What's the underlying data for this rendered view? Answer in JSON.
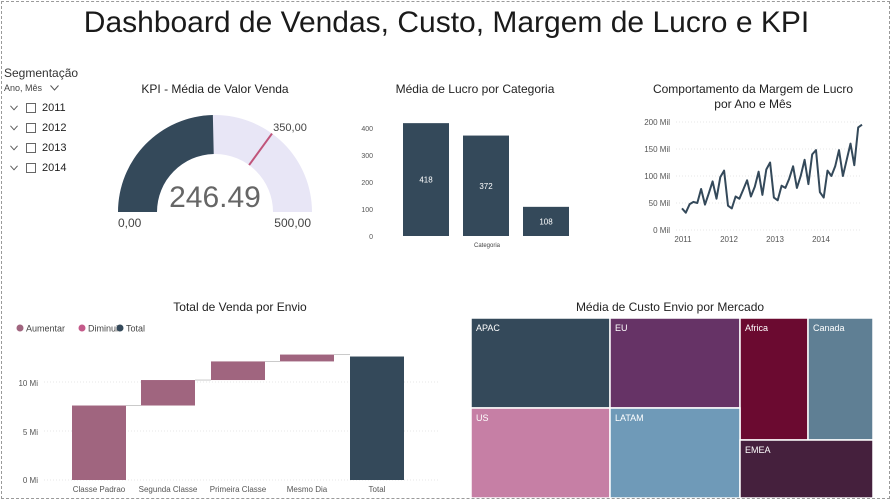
{
  "dashboard": {
    "title": "Dashboard de Vendas, Custo, Margem de Lucro e KPI"
  },
  "slicer": {
    "title": "Segmentação",
    "field": "Ano, Mês",
    "items": [
      {
        "label": "2011"
      },
      {
        "label": "2012"
      },
      {
        "label": "2013"
      },
      {
        "label": "2014"
      }
    ]
  },
  "colors": {
    "dark": "#34495a",
    "gauge_fill": "#e8e6f6",
    "target": "#c0547a",
    "increase": "#a0657f",
    "decrease": "#c45a8a"
  },
  "gauge": {
    "title": "KPI - Média de Valor Venda",
    "value_label": "246.49",
    "min_label": "0,00",
    "max_label": "500,00",
    "target_label": "350,00",
    "value": 246.49,
    "min": 0,
    "max": 500,
    "target": 350
  },
  "category_chart": {
    "title": "Média de Lucro por Categoria",
    "xlabel": "Categoria",
    "yticks": [
      "0",
      "100",
      "200",
      "300",
      "400"
    ]
  },
  "line_chart": {
    "title_line1": "Comportamento da Margem de Lucro",
    "title_line2": "por Ano e Mês",
    "yticks": [
      "0 Mil",
      "50 Mil",
      "100 Mil",
      "150 Mil",
      "200 Mil"
    ],
    "xticks": [
      "2011",
      "2012",
      "2013",
      "2014"
    ]
  },
  "waterfall": {
    "title": "Total de Venda por Envio",
    "legend": [
      {
        "label": "Aumentar",
        "color": "#a0657f"
      },
      {
        "label": "Diminuir",
        "color": "#c45a8a"
      },
      {
        "label": "Total",
        "color": "#34495a"
      }
    ],
    "yticks": [
      "0 Mi",
      "5 Mi",
      "10 Mi"
    ]
  },
  "treemap": {
    "title": "Média de Custo Envio por Mercado",
    "tiles": [
      {
        "label": "APAC",
        "color": "#34495a"
      },
      {
        "label": "EU",
        "color": "#663366"
      },
      {
        "label": "Africa",
        "color": "#6b0a30"
      },
      {
        "label": "Canada",
        "color": "#5f7f94"
      },
      {
        "label": "US",
        "color": "#c67fa5"
      },
      {
        "label": "LATAM",
        "color": "#6f9ab8"
      },
      {
        "label": "EMEA",
        "color": "#45203d"
      }
    ]
  },
  "chart_data": [
    {
      "type": "bar",
      "title": "Média de Lucro por Categoria",
      "xlabel": "Categoria",
      "ylabel": "",
      "ylim": [
        0,
        450
      ],
      "categories": [
        "",
        "",
        ""
      ],
      "values": [
        418,
        372,
        108
      ],
      "labels": [
        "418",
        "372",
        "108"
      ]
    },
    {
      "type": "line",
      "title": "Comportamento da Margem de Lucro por Ano e Mês",
      "ylim": [
        0,
        200
      ],
      "x": [
        "2011-01",
        "2011-02",
        "2011-03",
        "2011-04",
        "2011-05",
        "2011-06",
        "2011-07",
        "2011-08",
        "2011-09",
        "2011-10",
        "2011-11",
        "2011-12",
        "2012-01",
        "2012-02",
        "2012-03",
        "2012-04",
        "2012-05",
        "2012-06",
        "2012-07",
        "2012-08",
        "2012-09",
        "2012-10",
        "2012-11",
        "2012-12",
        "2013-01",
        "2013-02",
        "2013-03",
        "2013-04",
        "2013-05",
        "2013-06",
        "2013-07",
        "2013-08",
        "2013-09",
        "2013-10",
        "2013-11",
        "2013-12",
        "2014-01",
        "2014-02",
        "2014-03",
        "2014-04",
        "2014-05",
        "2014-06",
        "2014-07",
        "2014-08",
        "2014-09",
        "2014-10",
        "2014-11",
        "2014-12"
      ],
      "series": [
        {
          "values": [
            40,
            32,
            48,
            52,
            50,
            76,
            47,
            68,
            90,
            58,
            98,
            110,
            45,
            40,
            62,
            58,
            75,
            92,
            62,
            80,
            108,
            65,
            112,
            125,
            60,
            55,
            82,
            78,
            95,
            118,
            78,
            100,
            130,
            85,
            140,
            148,
            70,
            60,
            110,
            100,
            118,
            148,
            100,
            130,
            160,
            120,
            190,
            195
          ]
        }
      ]
    },
    {
      "type": "bar",
      "title": "Total de Venda por Envio",
      "ylim": [
        0,
        14
      ],
      "categories": [
        "Classe Padrao",
        "Segunda Classe",
        "Primeira Classe",
        "Mesmo Dia",
        "Total"
      ],
      "values": [
        7.6,
        2.6,
        1.9,
        0.7,
        12.6
      ],
      "kinds": [
        "Aumentar",
        "Aumentar",
        "Aumentar",
        "Aumentar",
        "Total"
      ]
    },
    {
      "type": "treemap",
      "title": "Média de Custo Envio por Mercado",
      "categories": [
        "APAC",
        "EU",
        "Africa",
        "Canada",
        "US",
        "LATAM",
        "EMEA"
      ],
      "values": [
        28,
        27,
        19,
        18,
        30,
        29,
        21
      ]
    }
  ]
}
